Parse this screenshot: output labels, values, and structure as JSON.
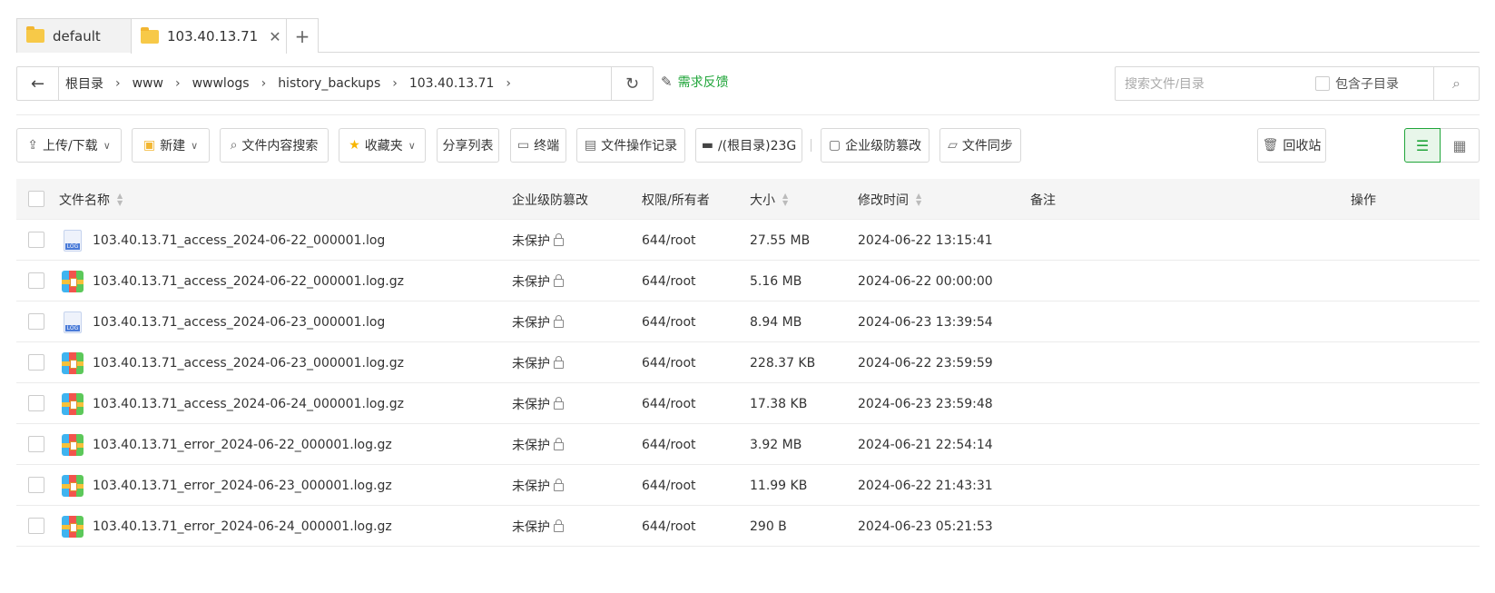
{
  "tabs": [
    {
      "label": "default"
    },
    {
      "label": "103.40.13.71"
    }
  ],
  "tab_add_label": "+",
  "path": {
    "crumbs": [
      "根目录",
      "www",
      "wwwlogs",
      "history_backups",
      "103.40.13.71"
    ]
  },
  "feedback_label": "需求反馈",
  "search": {
    "placeholder": "搜索文件/目录",
    "include_sub_label": "包含子目录"
  },
  "toolbar": {
    "upload_download": "上传/下载",
    "new": "新建",
    "content_search": "文件内容搜索",
    "favorites": "收藏夹",
    "share_list": "分享列表",
    "terminal": "终端",
    "op_log": "文件操作记录",
    "disk": "/(根目录)23G",
    "tamper_proof": "企业级防篡改",
    "file_sync": "文件同步",
    "recycle_bin": "回收站"
  },
  "table": {
    "headers": {
      "name": "文件名称",
      "tamper": "企业级防篡改",
      "perm": "权限/所有者",
      "size": "大小",
      "mtime": "修改时间",
      "note": "备注",
      "ops": "操作"
    },
    "rows": [
      {
        "name": "103.40.13.71_access_2024-06-22_000001.log",
        "type": "log",
        "tamper": "未保护",
        "perm": "644/root",
        "size": "27.55 MB",
        "mtime": "2024-06-22 13:15:41"
      },
      {
        "name": "103.40.13.71_access_2024-06-22_000001.log.gz",
        "type": "gz",
        "tamper": "未保护",
        "perm": "644/root",
        "size": "5.16 MB",
        "mtime": "2024-06-22 00:00:00"
      },
      {
        "name": "103.40.13.71_access_2024-06-23_000001.log",
        "type": "log",
        "tamper": "未保护",
        "perm": "644/root",
        "size": "8.94 MB",
        "mtime": "2024-06-23 13:39:54"
      },
      {
        "name": "103.40.13.71_access_2024-06-23_000001.log.gz",
        "type": "gz",
        "tamper": "未保护",
        "perm": "644/root",
        "size": "228.37 KB",
        "mtime": "2024-06-22 23:59:59"
      },
      {
        "name": "103.40.13.71_access_2024-06-24_000001.log.gz",
        "type": "gz",
        "tamper": "未保护",
        "perm": "644/root",
        "size": "17.38 KB",
        "mtime": "2024-06-23 23:59:48"
      },
      {
        "name": "103.40.13.71_error_2024-06-22_000001.log.gz",
        "type": "gz",
        "tamper": "未保护",
        "perm": "644/root",
        "size": "3.92 MB",
        "mtime": "2024-06-21 22:54:14"
      },
      {
        "name": "103.40.13.71_error_2024-06-23_000001.log.gz",
        "type": "gz",
        "tamper": "未保护",
        "perm": "644/root",
        "size": "11.99 KB",
        "mtime": "2024-06-22 21:43:31"
      },
      {
        "name": "103.40.13.71_error_2024-06-24_000001.log.gz",
        "type": "gz",
        "tamper": "未保护",
        "perm": "644/root",
        "size": "290 B",
        "mtime": "2024-06-23 05:21:53"
      }
    ]
  },
  "colors": {
    "accent": "#20a53a",
    "border": "#d9d9d9",
    "header_bg": "#f5f5f5"
  }
}
